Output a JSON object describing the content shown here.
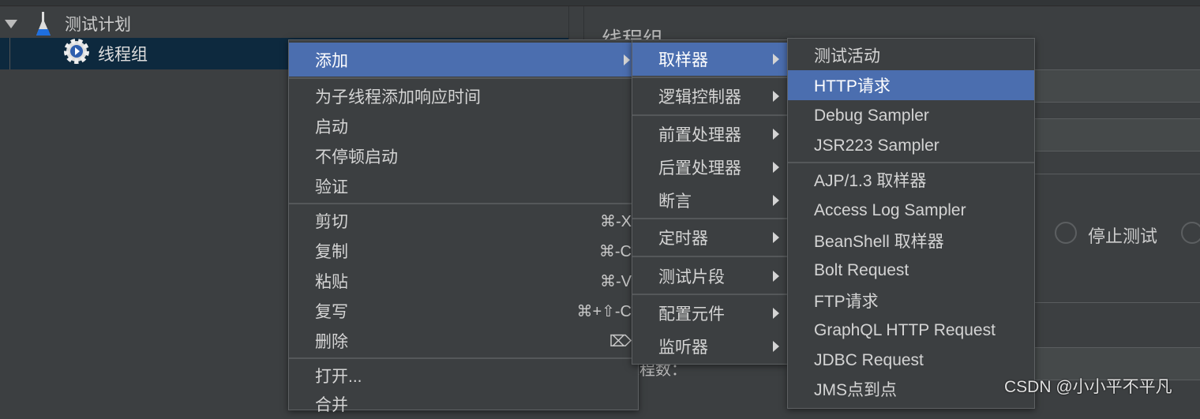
{
  "tree": {
    "items": [
      {
        "label": "测试计划",
        "icon": "flask-icon",
        "expanded": true
      },
      {
        "label": "线程组",
        "icon": "gear-icon",
        "selected": true
      }
    ]
  },
  "panel": {
    "title": "线程组",
    "radio_stop_test": "停止测试",
    "thread_count_label": "线程数："
  },
  "context_menu": {
    "groups": [
      [
        {
          "label": "添加",
          "submenu": true,
          "highlighted": true
        }
      ],
      [
        {
          "label": "为子线程添加响应时间"
        },
        {
          "label": "启动"
        },
        {
          "label": "不停顿启动"
        },
        {
          "label": "验证"
        }
      ],
      [
        {
          "label": "剪切",
          "shortcut": "⌘-X"
        },
        {
          "label": "复制",
          "shortcut": "⌘-C"
        },
        {
          "label": "粘贴",
          "shortcut": "⌘-V"
        },
        {
          "label": "复写",
          "shortcut": "⌘+⇧-C"
        },
        {
          "label": "删除",
          "shortcut": "⌦"
        }
      ],
      [
        {
          "label": "打开..."
        },
        {
          "label": "合并"
        }
      ]
    ]
  },
  "add_submenu": {
    "items": [
      "取样器",
      "逻辑控制器",
      "前置处理器",
      "后置处理器",
      "断言",
      "定时器",
      "测试片段",
      "配置元件",
      "监听器"
    ]
  },
  "sampler_submenu": {
    "items": [
      "测试活动",
      "HTTP请求",
      "Debug Sampler",
      "JSR223 Sampler",
      "AJP/1.3 取样器",
      "Access Log Sampler",
      "BeanShell 取样器",
      "Bolt Request",
      "FTP请求",
      "GraphQL HTTP Request",
      "JDBC Request",
      "JMS点到点"
    ],
    "highlighted": "HTTP请求"
  },
  "watermark": "CSDN @小小平不平凡",
  "colors": {
    "highlight": "#4b6eaf",
    "background": "#3c3f41",
    "tree_selected": "#0d293e"
  }
}
